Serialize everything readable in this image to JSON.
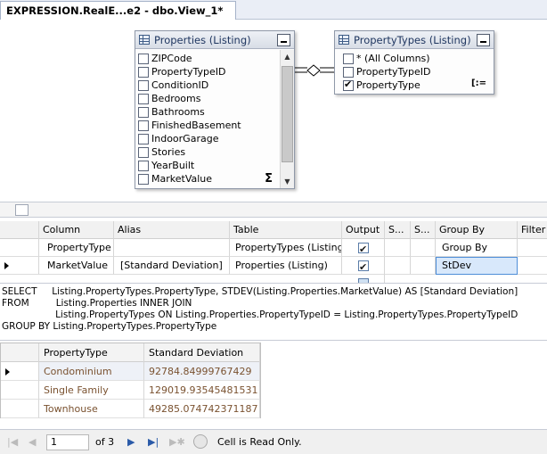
{
  "document_tab": {
    "title": "EXPRESSION.RealE...e2 - dbo.View_1*"
  },
  "diagram": {
    "properties_table": {
      "title": "Properties (Listing)",
      "columns": [
        {
          "name": "ZIPCode",
          "checked": false
        },
        {
          "name": "PropertyTypeID",
          "checked": false
        },
        {
          "name": "ConditionID",
          "checked": false
        },
        {
          "name": "Bedrooms",
          "checked": false
        },
        {
          "name": "Bathrooms",
          "checked": false
        },
        {
          "name": "FinishedBasement",
          "checked": false
        },
        {
          "name": "IndoorGarage",
          "checked": false
        },
        {
          "name": "Stories",
          "checked": false
        },
        {
          "name": "YearBuilt",
          "checked": false
        },
        {
          "name": "MarketValue",
          "checked": false,
          "aggregate_icon": "sigma-icon"
        }
      ],
      "aggregate_symbol": "Σ"
    },
    "property_types_table": {
      "title": "PropertyTypes (Listing)",
      "columns": [
        {
          "name": "* (All Columns)",
          "checked": false
        },
        {
          "name": "PropertyTypeID",
          "checked": false
        },
        {
          "name": "PropertyType",
          "checked": true,
          "group_icon": "group-by-icon"
        }
      ],
      "group_symbol": "[:="
    }
  },
  "criteria": {
    "headers": [
      "Column",
      "Alias",
      "Table",
      "Output",
      "S...",
      "S...",
      "Group By",
      "Filter"
    ],
    "rows": [
      {
        "column": "PropertyType",
        "alias": "",
        "table": "PropertyTypes (Listing)",
        "output": true,
        "group_by": "Group By"
      },
      {
        "column": "MarketValue",
        "alias": "[Standard Deviation]",
        "table": "Properties (Listing)",
        "output": true,
        "group_by": "StDev"
      }
    ]
  },
  "sql": {
    "lines": [
      "SELECT     Listing.PropertyTypes.PropertyType, STDEV(Listing.Properties.MarketValue) AS [Standard Deviation]",
      "FROM         Listing.Properties INNER JOIN",
      "                  Listing.PropertyTypes ON Listing.Properties.PropertyTypeID = Listing.PropertyTypes.PropertyTypeID",
      "GROUP BY Listing.PropertyTypes.PropertyType"
    ]
  },
  "results": {
    "headers": [
      "PropertyType",
      "Standard Deviation"
    ],
    "rows": [
      {
        "property_type": "Condominium",
        "std_dev": "92784.84999767429"
      },
      {
        "property_type": "Single Family",
        "std_dev": "129019.93545481531"
      },
      {
        "property_type": "Townhouse",
        "std_dev": "49285.074742371187"
      }
    ]
  },
  "navigator": {
    "current_record": "1",
    "of_total": "of 3",
    "status": "Cell is Read Only."
  }
}
